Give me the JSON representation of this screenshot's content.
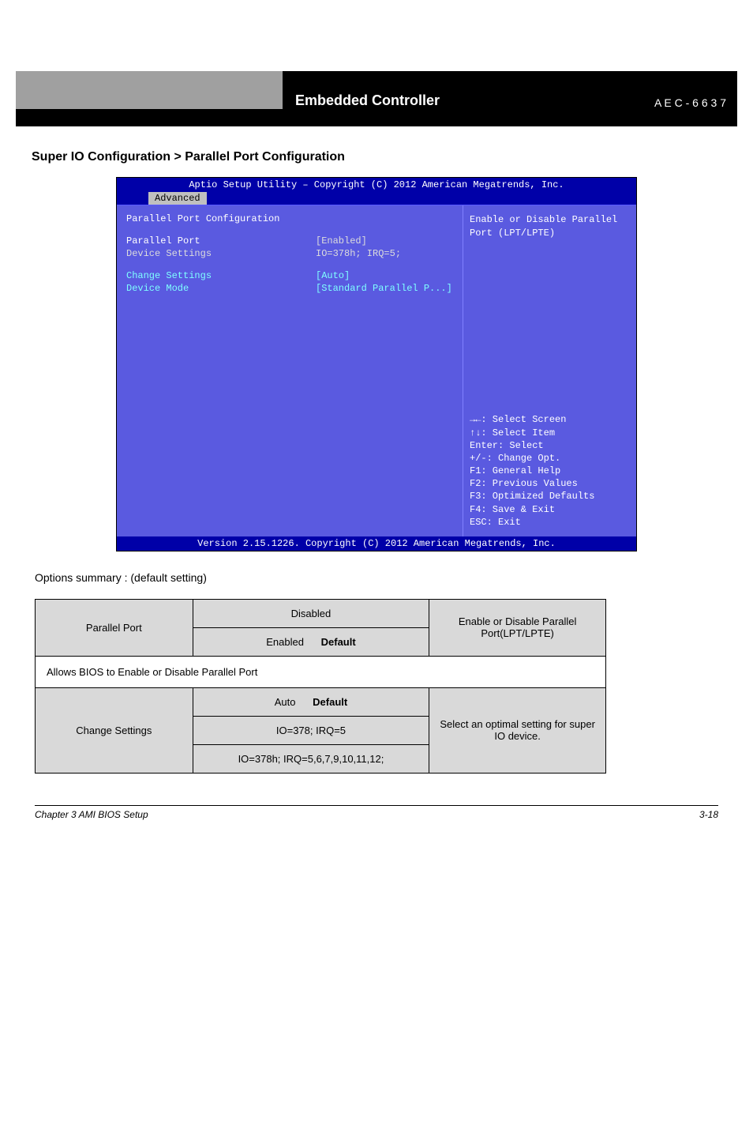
{
  "banner": {
    "board_name": "Embedded Controller",
    "brand_line": "A E C - 6 6 3 7"
  },
  "section_heading": "Super IO Configuration > Parallel Port Configuration",
  "bios": {
    "title_bar": "Aptio Setup Utility – Copyright (C) 2012 American Megatrends, Inc.",
    "tab": "Advanced",
    "section_title": "Parallel Port Configuration",
    "rows": [
      {
        "label": "Parallel Port",
        "value": "[Enabled]",
        "hl": true
      },
      {
        "label": "Device Settings",
        "value": "IO=378h; IRQ=5;"
      },
      {
        "label": "",
        "value": ""
      },
      {
        "label": "Change Settings",
        "value": "[Auto]"
      },
      {
        "label": "Device Mode",
        "value": "[Standard Parallel P...]"
      }
    ],
    "help_text": "Enable or Disable Parallel Port (LPT/LPTE)",
    "nav": [
      "→←: Select Screen",
      "↑↓: Select Item",
      "Enter: Select",
      "+/-: Change Opt.",
      "F1: General Help",
      "F2: Previous Values",
      "F3: Optimized Defaults",
      "F4: Save & Exit",
      "ESC: Exit"
    ],
    "footer": "Version 2.15.1226. Copyright (C) 2012 American Megatrends, Inc."
  },
  "doc_paragraph": "Options summary : (default setting)",
  "table": {
    "r1": {
      "a": "Parallel Port",
      "b1": "Disabled",
      "b2_label": "Enabled",
      "b2_flag": "Default",
      "c": "Enable or Disable Parallel Port(LPT/LPTE)"
    },
    "r_full": "Allows BIOS to Enable or Disable Parallel Port",
    "r2": {
      "a": "Change Settings",
      "b1_label": "Auto",
      "b1_flag": "Default",
      "b2": "IO=378; IRQ=5",
      "b3": "IO=378h; IRQ=5,6,7,9,10,11,12;",
      "c": "Select an optimal setting for super IO device."
    }
  },
  "footer": {
    "left": "Chapter 3 AMI BIOS Setup",
    "right": "3-18"
  }
}
